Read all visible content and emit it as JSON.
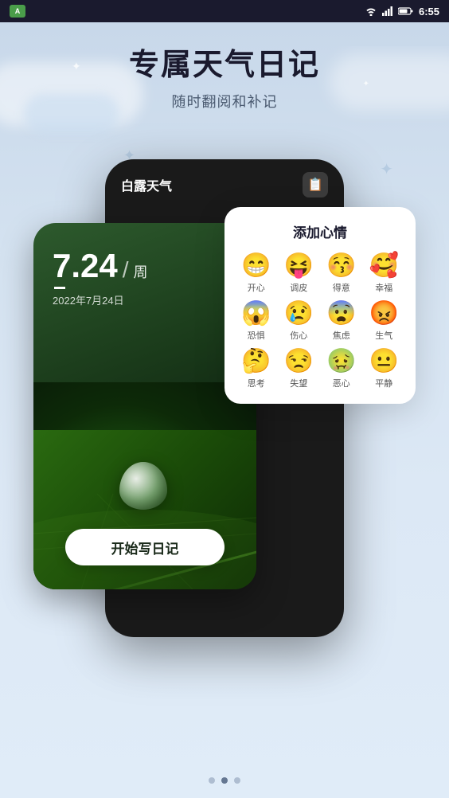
{
  "statusBar": {
    "leftLabel": "A",
    "time": "6:55",
    "icons": [
      "wifi",
      "signal",
      "battery"
    ]
  },
  "header": {
    "mainTitle": "专属天气日记",
    "subTitle": "随时翻阅和补记"
  },
  "appCard": {
    "appName": "白露天气",
    "calendarIcon": "📅"
  },
  "dateCard": {
    "dateNumber": "7.24",
    "slash": "/",
    "week": "周",
    "cursor": "_",
    "dateFull": "2022年7月24日"
  },
  "startButton": {
    "label": "开始写日记"
  },
  "emotionPanel": {
    "title": "添加心情",
    "emotions": [
      {
        "emoji": "😁",
        "label": "开心"
      },
      {
        "emoji": "😝",
        "label": "调皮"
      },
      {
        "emoji": "😚",
        "label": "得意"
      },
      {
        "emoji": "🥰",
        "label": "幸福"
      },
      {
        "emoji": "😱",
        "label": "恐惧"
      },
      {
        "emoji": "😢",
        "label": "伤心"
      },
      {
        "emoji": "😨",
        "label": "焦虑"
      },
      {
        "emoji": "😡",
        "label": "生气"
      },
      {
        "emoji": "🤔",
        "label": "思考"
      },
      {
        "emoji": "😒",
        "label": "失望"
      },
      {
        "emoji": "🤢",
        "label": "恶心"
      },
      {
        "emoji": "😐",
        "label": "平静"
      }
    ]
  },
  "pageDots": {
    "count": 3,
    "active": 1
  }
}
